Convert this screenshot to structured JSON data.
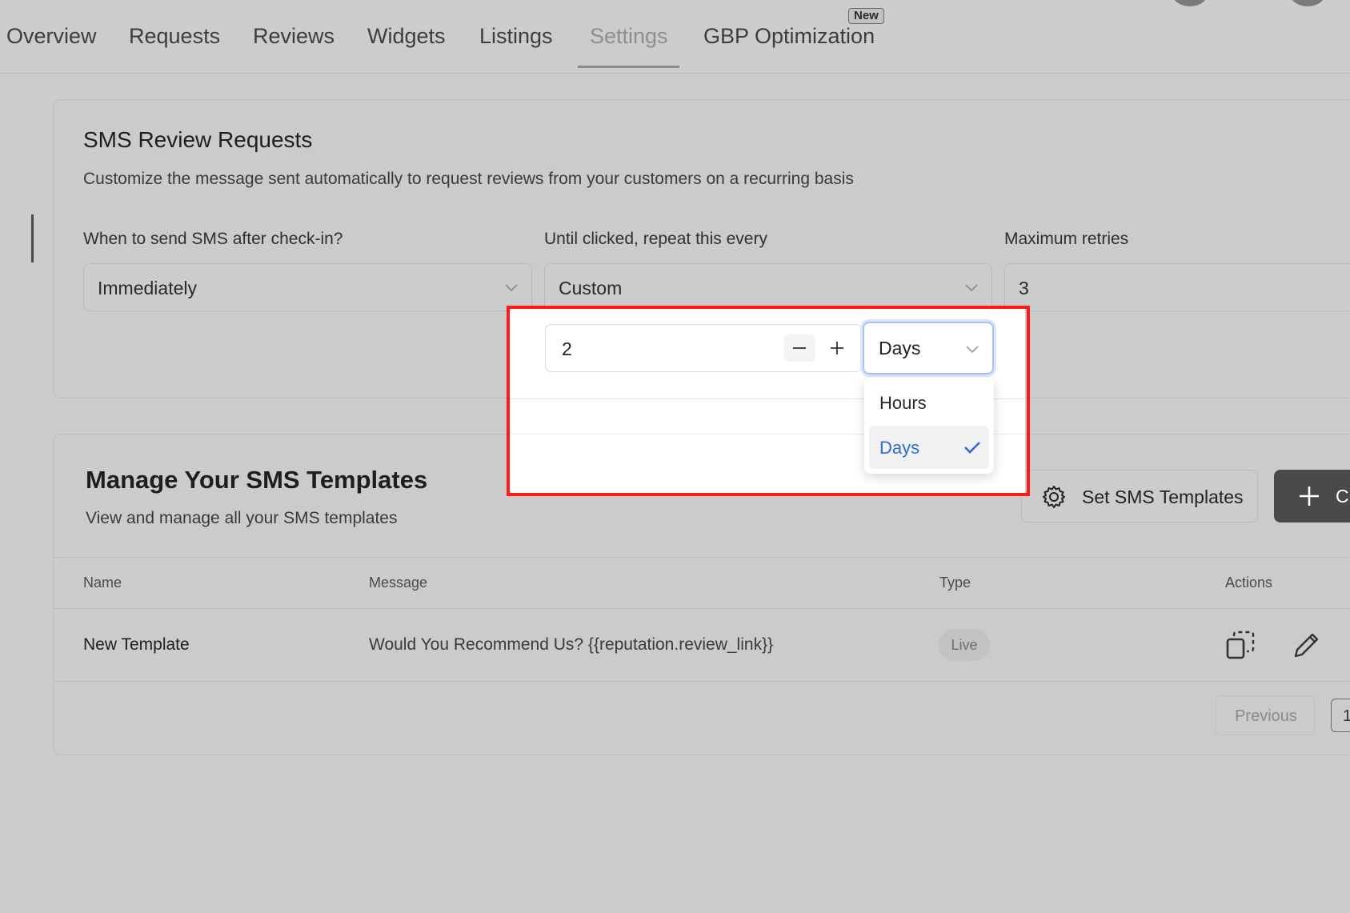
{
  "nav": {
    "tabs": [
      {
        "label": "Overview"
      },
      {
        "label": "Requests"
      },
      {
        "label": "Reviews"
      },
      {
        "label": "Widgets"
      },
      {
        "label": "Listings"
      },
      {
        "label": "Settings",
        "active": true
      },
      {
        "label": "GBP Optimization"
      }
    ],
    "new_badge": "New"
  },
  "sms_review": {
    "title": "SMS Review Requests",
    "subtitle": "Customize the message sent automatically to request reviews from your customers on a recurring basis",
    "when_label": "When to send SMS after check-in?",
    "when_value": "Immediately",
    "repeat_label": "Until clicked, repeat this every",
    "repeat_value": "Custom",
    "retries_label": "Maximum retries",
    "retries_value": "3",
    "custom_interval": {
      "amount": "2",
      "unit": "Days",
      "unit_options": [
        {
          "label": "Hours",
          "selected": false
        },
        {
          "label": "Days",
          "selected": true
        }
      ]
    }
  },
  "templates": {
    "title": "Manage Your SMS Templates",
    "subtitle": "View and manage all your SMS templates",
    "set_button": "Set SMS Templates",
    "create_button": "C",
    "columns": [
      "Name",
      "Message",
      "Type",
      "Actions"
    ],
    "rows": [
      {
        "name": "New Template",
        "message": "Would You Recommend Us? {{reputation.review_link}}",
        "type": "Live"
      }
    ],
    "pagination": {
      "previous": "Previous",
      "page": "1"
    }
  },
  "colors": {
    "highlight_outline": "#ff1a1a",
    "selected_option": "#2f6bd9",
    "primary_button": "#4a4a4a"
  }
}
